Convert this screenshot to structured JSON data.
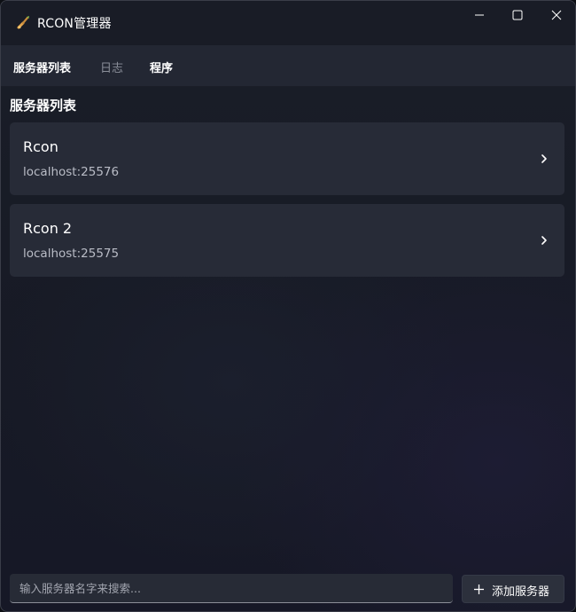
{
  "window": {
    "title": "RCON管理器",
    "icon": "brush-icon",
    "controls": {
      "minimize": "minimize-icon",
      "maximize": "maximize-icon",
      "close": "close-icon"
    }
  },
  "nav": {
    "tabs": [
      {
        "label": "服务器列表",
        "active": true
      },
      {
        "label": "日志",
        "active": false
      },
      {
        "label": "程序",
        "active": false
      }
    ]
  },
  "main": {
    "section_title": "服务器列表",
    "servers": [
      {
        "name": "Rcon",
        "address": "localhost:25576"
      },
      {
        "name": "Rcon 2",
        "address": "localhost:25575"
      }
    ]
  },
  "footer": {
    "search_placeholder": "输入服务器名字来搜索...",
    "add_label": "添加服务器"
  },
  "colors": {
    "background": "#171a25",
    "card": "#272b37",
    "navbar": "#232733",
    "text_primary": "#ffffff",
    "text_secondary": "#b9bcc6"
  }
}
